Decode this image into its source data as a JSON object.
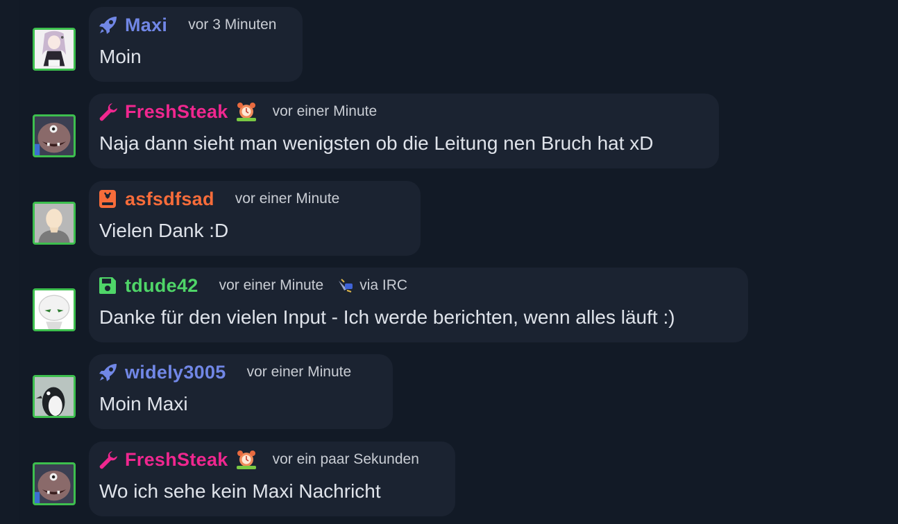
{
  "colors": {
    "background": "#121a26",
    "bubble": "#1b2331",
    "avatar_border": "#3dbf4e",
    "meta_text": "#c9cdd4",
    "message_text": "#dfe3ea"
  },
  "messages": [
    {
      "username": "Maxi",
      "role_icon": "rocket-icon",
      "name_color": "#7187e6",
      "time": "vor 3 Minuten",
      "text": "Moin",
      "avatar": "anime-girl-avatar"
    },
    {
      "username": "FreshSteak",
      "role_icon": "wrench-icon",
      "name_color": "#f0278f",
      "badge": "alarm-clock-badge",
      "time": "vor einer Minute",
      "text": "Naja dann sieht man wenigsten ob die Leitung nen Bruch hat xD",
      "avatar": "monster-face-avatar"
    },
    {
      "username": "asfsdfsad",
      "role_icon": "book-icon",
      "name_color": "#f76c3a",
      "time": "vor einer Minute",
      "text": "Vielen Dank :D",
      "avatar": "default-person-avatar"
    },
    {
      "username": "tdude42",
      "role_icon": "floppy-disk-icon",
      "name_color": "#4fd568",
      "time": "vor einer Minute",
      "via": "via IRC",
      "text": "Danke für den vielen Input - Ich werde berichten, wenn alles läuft :)",
      "avatar": "robot-face-avatar"
    },
    {
      "username": "widely3005",
      "role_icon": "rocket-icon",
      "name_color": "#7187e6",
      "time": "vor einer Minute",
      "text": "Moin Maxi",
      "avatar": "penguin-avatar"
    },
    {
      "username": "FreshSteak",
      "role_icon": "wrench-icon",
      "name_color": "#f0278f",
      "badge": "alarm-clock-badge",
      "time": "vor ein paar Sekunden",
      "text": "Wo ich sehe kein Maxi Nachricht",
      "avatar": "monster-face-avatar"
    }
  ]
}
